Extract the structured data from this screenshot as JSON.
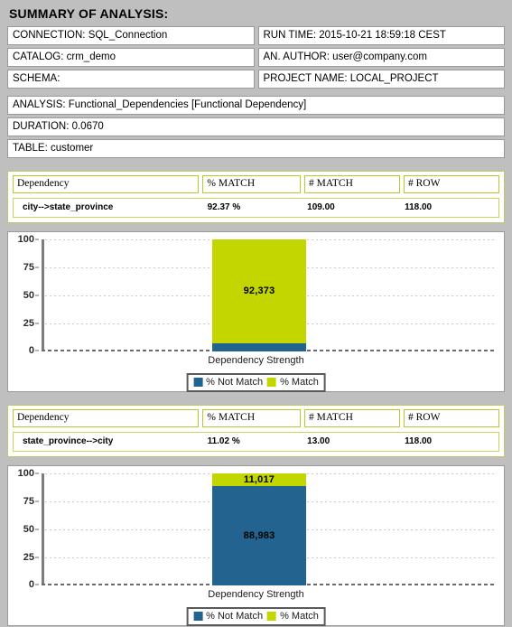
{
  "summary": {
    "title": "SUMMARY OF ANALYSIS:",
    "connection": "CONNECTION: SQL_Connection",
    "run_time": "RUN TIME: 2015-10-21 18:59:18 CEST",
    "catalog": "CATALOG: crm_demo",
    "author": "AN. AUTHOR: user@company.com",
    "schema": "SCHEMA:",
    "project": "PROJECT NAME: LOCAL_PROJECT",
    "analysis": "ANALYSIS: Functional_Dependencies [Functional Dependency]",
    "duration": "DURATION: 0.0670",
    "table": "TABLE: customer"
  },
  "colors": {
    "match": "#c4d600",
    "not_match": "#22648f",
    "page_bg": "#bfbfbf",
    "table_border": "#b6ca2e"
  },
  "columns": [
    "Dependency",
    "% MATCH",
    "# MATCH",
    "# ROW"
  ],
  "results": [
    {
      "dependency": "city-->state_province",
      "pct_match": "92.37 %",
      "num_match": "109.00",
      "num_row": "118.00"
    },
    {
      "dependency": "state_province-->city",
      "pct_match": "11.02 %",
      "num_match": "13.00",
      "num_row": "118.00"
    }
  ],
  "legend": {
    "not_match": "% Not Match",
    "match": "% Match"
  },
  "chart_data": [
    {
      "type": "bar",
      "stacked": true,
      "title": "",
      "xlabel": "Dependency Strength",
      "ylabel": "",
      "ylim": [
        0,
        100
      ],
      "yticks": [
        0,
        25,
        50,
        75,
        100
      ],
      "grid": true,
      "legend_position": "bottom",
      "categories": [
        "Dependency Strength"
      ],
      "series": [
        {
          "name": "% Not Match",
          "values": [
            7.627
          ],
          "color": "#22648f",
          "label": ""
        },
        {
          "name": "% Match",
          "values": [
            92.373
          ],
          "color": "#c4d600",
          "label": "92,373"
        }
      ]
    },
    {
      "type": "bar",
      "stacked": true,
      "title": "",
      "xlabel": "Dependency Strength",
      "ylabel": "",
      "ylim": [
        0,
        100
      ],
      "yticks": [
        0,
        25,
        50,
        75,
        100
      ],
      "grid": true,
      "legend_position": "bottom",
      "categories": [
        "Dependency Strength"
      ],
      "series": [
        {
          "name": "% Not Match",
          "values": [
            88.983
          ],
          "color": "#22648f",
          "label": "88,983"
        },
        {
          "name": "% Match",
          "values": [
            11.017
          ],
          "color": "#c4d600",
          "label": "11,017"
        }
      ]
    }
  ]
}
